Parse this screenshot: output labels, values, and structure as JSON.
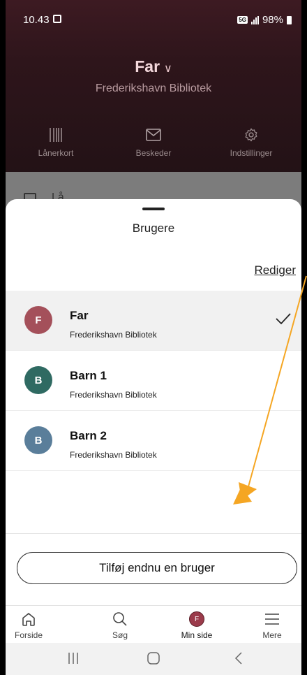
{
  "status": {
    "time": "10.43",
    "network": "5G",
    "battery": "98%"
  },
  "header": {
    "user_name": "Far",
    "user_chevron": "∨",
    "library": "Frederikshavn Bibliotek",
    "actions": [
      {
        "label": "Lånerkort",
        "icon": "barcode-icon"
      },
      {
        "label": "Beskeder",
        "icon": "mail-icon"
      },
      {
        "label": "Indstillinger",
        "icon": "gear-icon"
      }
    ],
    "partial_text": "Lå"
  },
  "sheet": {
    "title": "Brugere",
    "edit_label": "Rediger",
    "users": [
      {
        "initial": "F",
        "name": "Far",
        "library": "Frederikshavn Bibliotek",
        "color": "#a4505a",
        "selected": true
      },
      {
        "initial": "B",
        "name": "Barn 1",
        "library": "Frederikshavn Bibliotek",
        "color": "#2f6a62",
        "selected": false
      },
      {
        "initial": "B",
        "name": "Barn 2",
        "library": "Frederikshavn Bibliotek",
        "color": "#5a7e9a",
        "selected": false
      }
    ],
    "add_button": "Tilføj endnu en bruger"
  },
  "bottom_nav": {
    "items": [
      {
        "label": "Forside",
        "icon": "home-icon"
      },
      {
        "label": "Søg",
        "icon": "search-icon"
      },
      {
        "label": "Min side",
        "icon": "avatar-icon",
        "initial": "F",
        "active": true
      },
      {
        "label": "Mere",
        "icon": "menu-icon"
      }
    ]
  },
  "colors": {
    "accent": "#9b3b4b",
    "annotation": "#f5a623"
  }
}
